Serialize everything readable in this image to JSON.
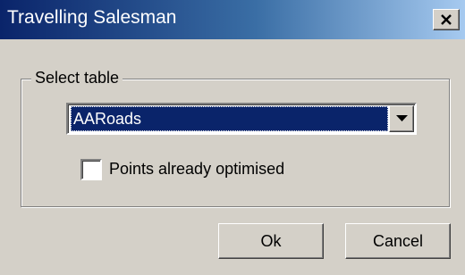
{
  "window": {
    "title": "Travelling Salesman",
    "close_glyph": "close-icon"
  },
  "group": {
    "label": "Select table"
  },
  "table_select": {
    "selected_value": "AARoads",
    "arrow_icon": "chevron-down-icon"
  },
  "options": {
    "points_optimised_label": "Points already optimised",
    "points_optimised_checked": false
  },
  "buttons": {
    "ok_label": "Ok",
    "cancel_label": "Cancel"
  },
  "colors": {
    "titlebar_start": "#0a246a",
    "titlebar_end": "#a6caf0",
    "selection_bg": "#0a246a",
    "dialog_bg": "#d4d0c8"
  }
}
